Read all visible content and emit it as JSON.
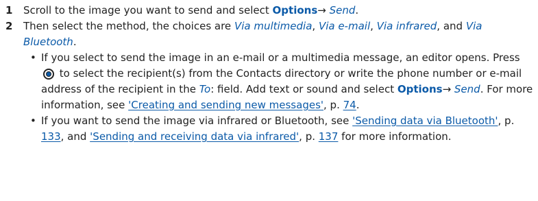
{
  "step1": {
    "number": "1",
    "text_before": "Scroll to the image you want to send and select ",
    "options_label": "Options",
    "arrow": "→ ",
    "send_label": "Send",
    "text_after": "."
  },
  "step2": {
    "number": "2",
    "text_before": "Then select the method, the choices are ",
    "via_multimedia": "Via multimedia",
    "sep1": ", ",
    "via_email": "Via e-mail",
    "sep2": ", ",
    "via_infrared": "Via infrared",
    "sep3": ", and ",
    "via_bluetooth": "Via Bluetooth",
    "text_after": "."
  },
  "bullet1": {
    "marker": "•",
    "text1": "If you select to send the image in an e-mail or a multimedia message, an editor opens. Press ",
    "icon": "scroll-key-icon",
    "text2": " to select the recipient(s) from the Contacts directory or write the phone number or e-mail address of the recipient in the ",
    "to_label": "To",
    "text3": ": field. Add text or sound and select ",
    "options_label": "Options",
    "arrow": "→ ",
    "send_label": "Send",
    "text4": ". For more information, see ",
    "link_text": "'Creating and sending new messages'",
    "page_prefix": ", p. ",
    "page_num": "74",
    "text5": "."
  },
  "bullet2": {
    "marker": "•",
    "text1": "If you want to send the image via infrared or Bluetooth, see ",
    "link1_text": "'Sending data via Bluetooth'",
    "page_prefix1": ", p. ",
    "page1": "133",
    "text2": ", and ",
    "link2_text": "'Sending and receiving data via infrared'",
    "page_prefix2": ", p. ",
    "page2": "137",
    "text3": " for more information."
  },
  "colors": {
    "accent": "#0b5aa8",
    "text": "#222222"
  }
}
